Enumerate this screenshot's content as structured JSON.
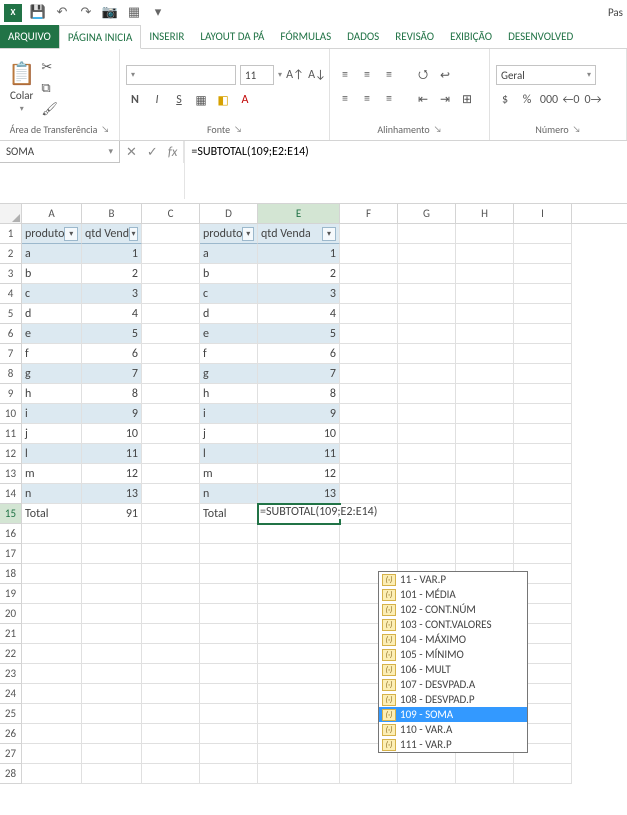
{
  "titlebar": {
    "right_label": "Pas"
  },
  "tabs": {
    "file": "ARQUIVO",
    "items": [
      "PÁGINA INICIA",
      "INSERIR",
      "LAYOUT DA PÁ",
      "FÓRMULAS",
      "DADOS",
      "REVISÃO",
      "EXIBIÇÃO",
      "DESENVOLVED"
    ],
    "active_index": 0
  },
  "ribbon": {
    "clipboard": {
      "paste": "Colar",
      "group_label": "Área de Transferência"
    },
    "font": {
      "font_size": "11",
      "group_label": "Fonte"
    },
    "alignment": {
      "group_label": "Alinhamento"
    },
    "number": {
      "format": "Geral",
      "group_label": "Número"
    }
  },
  "formula_bar": {
    "name_box": "SOMA",
    "formula": "=SUBTOTAL(109;E2:E14)"
  },
  "columns": [
    "A",
    "B",
    "C",
    "D",
    "E",
    "F",
    "G",
    "H",
    "I"
  ],
  "active_col_index": 4,
  "active_row": 15,
  "table1": {
    "headers": [
      "produto",
      "qtd Vend"
    ],
    "rows": [
      [
        "a",
        "1"
      ],
      [
        "b",
        "2"
      ],
      [
        "c",
        "3"
      ],
      [
        "d",
        "4"
      ],
      [
        "e",
        "5"
      ],
      [
        "f",
        "6"
      ],
      [
        "g",
        "7"
      ],
      [
        "h",
        "8"
      ],
      [
        "i",
        "9"
      ],
      [
        "j",
        "10"
      ],
      [
        "l",
        "11"
      ],
      [
        "m",
        "12"
      ],
      [
        "n",
        "13"
      ]
    ],
    "total_label": "Total",
    "total_value": "91"
  },
  "table2": {
    "headers": [
      "produto",
      "qtd Venda"
    ],
    "rows": [
      [
        "a",
        "1"
      ],
      [
        "b",
        "2"
      ],
      [
        "c",
        "3"
      ],
      [
        "d",
        "4"
      ],
      [
        "e",
        "5"
      ],
      [
        "f",
        "6"
      ],
      [
        "g",
        "7"
      ],
      [
        "h",
        "8"
      ],
      [
        "i",
        "9"
      ],
      [
        "j",
        "10"
      ],
      [
        "l",
        "11"
      ],
      [
        "m",
        "12"
      ],
      [
        "n",
        "13"
      ]
    ],
    "total_label": "Total",
    "editing_text": "=SUBTOTAL(109;E2:E14)"
  },
  "autocomplete": {
    "items": [
      "11 - VAR.P",
      "101 - MÉDIA",
      "102 - CONT.NÚM",
      "103 - CONT.VALORES",
      "104 - MÁXIMO",
      "105 - MÍNIMO",
      "106 - MULT",
      "107 - DESVPAD.A",
      "108 - DESVPAD.P",
      "109 - SOMA",
      "110 - VAR.A",
      "111 - VAR.P"
    ],
    "selected_index": 9
  }
}
